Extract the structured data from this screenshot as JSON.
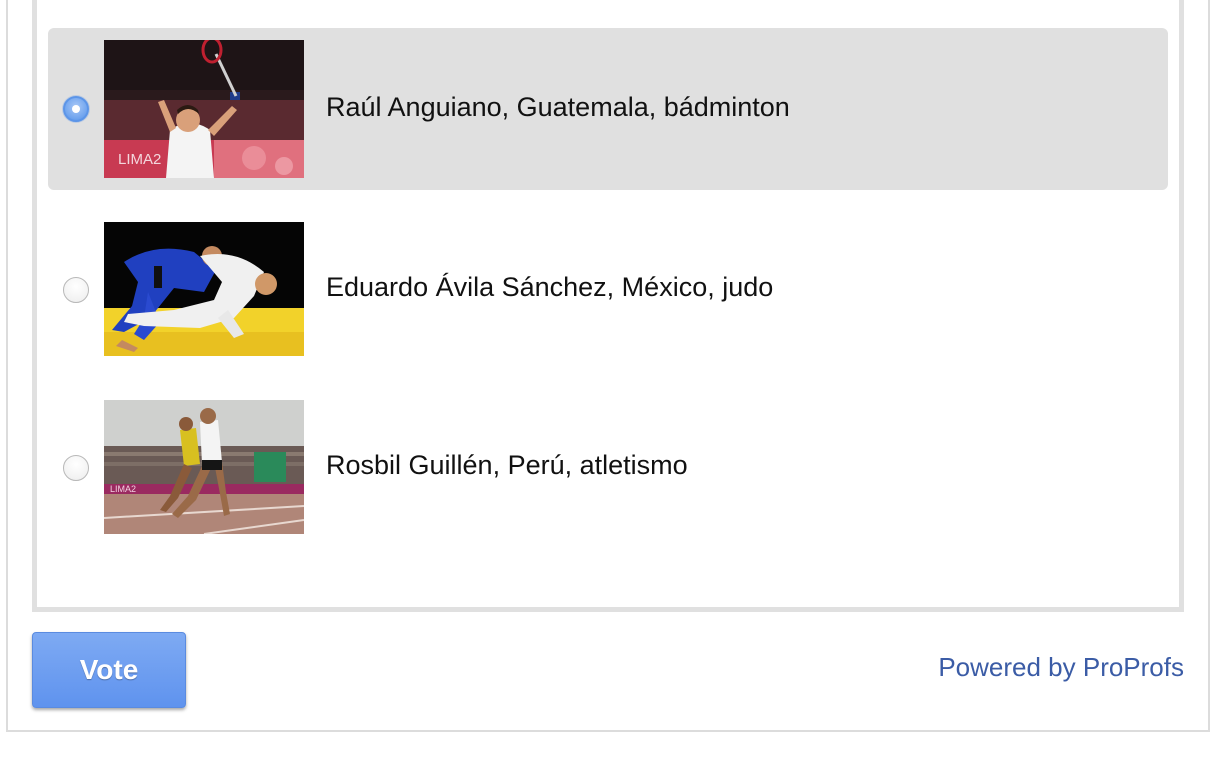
{
  "poll": {
    "options": [
      {
        "label": "Raúl Anguiano, Guatemala, bádminton",
        "selected": true,
        "thumbnail_icon": "badminton-photo"
      },
      {
        "label": "Eduardo Ávila Sánchez, México, judo",
        "selected": false,
        "thumbnail_icon": "judo-photo"
      },
      {
        "label": "Rosbil Guillén, Perú, atletismo",
        "selected": false,
        "thumbnail_icon": "athletics-photo"
      }
    ]
  },
  "footer": {
    "vote_label": "Vote",
    "powered_by": "Powered by ProProfs"
  },
  "photo_text": {
    "lima_logo": "LIMA2"
  },
  "colors": {
    "selected_bg": "#e0e0e0",
    "radio_checked": "#5c95e8",
    "vote_button": "#6b9cf0",
    "powered_link": "#3b5ca6"
  }
}
